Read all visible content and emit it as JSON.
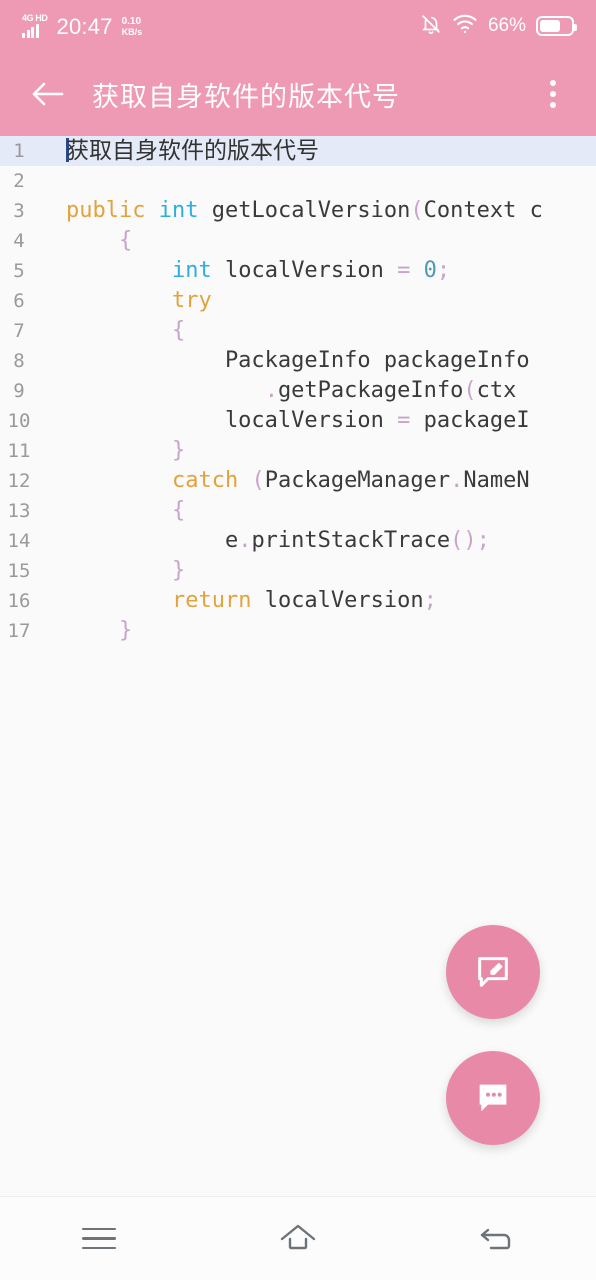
{
  "status_bar": {
    "network_label": "4G HD",
    "signal_bars": 4,
    "time": "20:47",
    "net_speed_value": "0.10",
    "net_speed_unit": "KB/s",
    "mute_icon": "bell-muted-icon",
    "wifi_icon": "wifi-icon",
    "battery_percent": "66%",
    "battery_level": 66,
    "background_color": "#EE9AB5"
  },
  "app_bar": {
    "back_icon": "arrow-left-icon",
    "title": "获取自身软件的版本代号",
    "overflow_icon": "more-vertical-icon",
    "background_color": "#EE9AB5"
  },
  "editor": {
    "selected_line": 1,
    "highlight_color": "#E4EAF7",
    "background_color": "#FAFAFA",
    "lines": [
      {
        "n": "1",
        "type": "text",
        "text": "获取自身软件的版本代号",
        "selected": true
      },
      {
        "n": "2",
        "type": "code",
        "tokens": []
      },
      {
        "n": "3",
        "type": "code",
        "tokens": [
          {
            "t": "public",
            "c": "kw"
          },
          {
            "t": " ",
            "c": "id"
          },
          {
            "t": "int",
            "c": "typ"
          },
          {
            "t": " getLocalVersion",
            "c": "id"
          },
          {
            "t": "(",
            "c": "pun"
          },
          {
            "t": "Context ",
            "c": "id"
          },
          {
            "t": "c",
            "c": "id"
          }
        ]
      },
      {
        "n": "4",
        "type": "code",
        "tokens": [
          {
            "t": "    ",
            "c": "id"
          },
          {
            "t": "{",
            "c": "pun"
          }
        ]
      },
      {
        "n": "5",
        "type": "code",
        "tokens": [
          {
            "t": "        ",
            "c": "id"
          },
          {
            "t": "int",
            "c": "typ"
          },
          {
            "t": " localVersion ",
            "c": "id"
          },
          {
            "t": "=",
            "c": "pun"
          },
          {
            "t": " ",
            "c": "id"
          },
          {
            "t": "0",
            "c": "num"
          },
          {
            "t": ";",
            "c": "pun"
          }
        ]
      },
      {
        "n": "6",
        "type": "code",
        "tokens": [
          {
            "t": "        ",
            "c": "id"
          },
          {
            "t": "try",
            "c": "kw"
          }
        ]
      },
      {
        "n": "7",
        "type": "code",
        "tokens": [
          {
            "t": "        ",
            "c": "id"
          },
          {
            "t": "{",
            "c": "pun"
          }
        ]
      },
      {
        "n": "8",
        "type": "code",
        "tokens": [
          {
            "t": "            PackageInfo packageInfo",
            "c": "id"
          }
        ]
      },
      {
        "n": "9",
        "type": "code",
        "tokens": [
          {
            "t": "               ",
            "c": "id"
          },
          {
            "t": ".",
            "c": "pun"
          },
          {
            "t": "getPackageInfo",
            "c": "id"
          },
          {
            "t": "(",
            "c": "pun"
          },
          {
            "t": "ctx",
            "c": "id"
          }
        ]
      },
      {
        "n": "10",
        "type": "code",
        "tokens": [
          {
            "t": "            localVersion ",
            "c": "id"
          },
          {
            "t": "=",
            "c": "pun"
          },
          {
            "t": " packageI",
            "c": "id"
          }
        ]
      },
      {
        "n": "11",
        "type": "code",
        "tokens": [
          {
            "t": "        ",
            "c": "id"
          },
          {
            "t": "}",
            "c": "pun"
          }
        ]
      },
      {
        "n": "12",
        "type": "code",
        "tokens": [
          {
            "t": "        ",
            "c": "id"
          },
          {
            "t": "catch",
            "c": "kw"
          },
          {
            "t": " ",
            "c": "id"
          },
          {
            "t": "(",
            "c": "pun"
          },
          {
            "t": "PackageManager",
            "c": "id"
          },
          {
            "t": ".",
            "c": "pun"
          },
          {
            "t": "NameN",
            "c": "id"
          }
        ]
      },
      {
        "n": "13",
        "type": "code",
        "tokens": [
          {
            "t": "        ",
            "c": "id"
          },
          {
            "t": "{",
            "c": "pun"
          }
        ]
      },
      {
        "n": "14",
        "type": "code",
        "tokens": [
          {
            "t": "            e",
            "c": "id"
          },
          {
            "t": ".",
            "c": "pun"
          },
          {
            "t": "printStackTrace",
            "c": "id"
          },
          {
            "t": "();",
            "c": "pun"
          }
        ]
      },
      {
        "n": "15",
        "type": "code",
        "tokens": [
          {
            "t": "        ",
            "c": "id"
          },
          {
            "t": "}",
            "c": "pun"
          }
        ]
      },
      {
        "n": "16",
        "type": "code",
        "tokens": [
          {
            "t": "        ",
            "c": "id"
          },
          {
            "t": "return",
            "c": "kw"
          },
          {
            "t": " localVersion",
            "c": "id"
          },
          {
            "t": ";",
            "c": "pun"
          }
        ]
      },
      {
        "n": "17",
        "type": "code",
        "tokens": [
          {
            "t": "    ",
            "c": "id"
          },
          {
            "t": "}",
            "c": "pun"
          }
        ]
      }
    ],
    "syntax_colors": {
      "keyword": "#E2A33C",
      "type": "#2FAEDD",
      "number": "#4E9AAE",
      "punctuation": "#C9A3CB",
      "identifier": "#3A3A3A"
    }
  },
  "fabs": [
    {
      "name": "comment-edit-fab",
      "icon": "comment-edit-icon",
      "color": "#E889A8"
    },
    {
      "name": "comment-fab",
      "icon": "comment-dots-icon",
      "color": "#E889A8"
    }
  ],
  "nav_bar": {
    "items": [
      {
        "name": "nav-recents-button",
        "icon": "menu-icon"
      },
      {
        "name": "nav-home-button",
        "icon": "home-icon"
      },
      {
        "name": "nav-back-button",
        "icon": "back-arrow-icon"
      }
    ]
  }
}
